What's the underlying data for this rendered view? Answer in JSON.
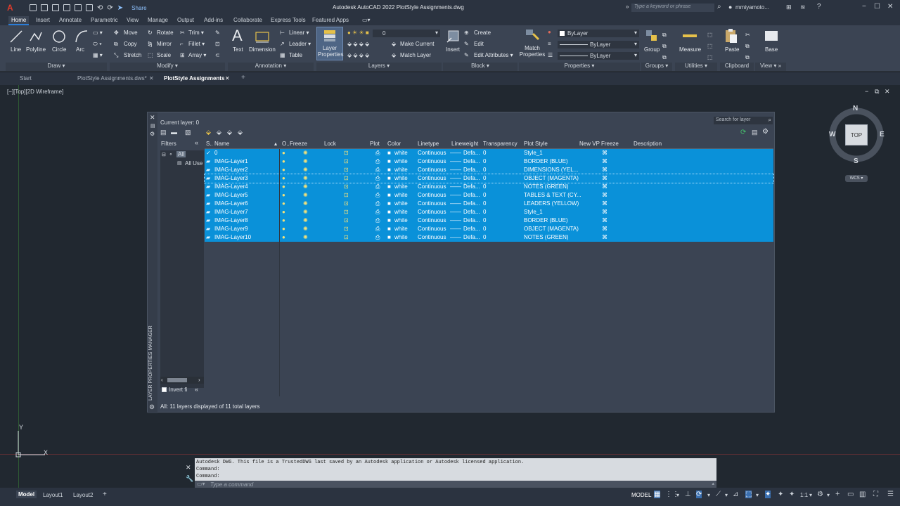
{
  "titlebar": {
    "logo": "A",
    "share": "Share",
    "title": "Autodesk AutoCAD 2022   PlotStyle Assignments.dwg",
    "search_placeholder": "Type a keyword or phrase",
    "user": "mmiyamoto..."
  },
  "ribbon_tabs": [
    "Home",
    "Insert",
    "Annotate",
    "Parametric",
    "View",
    "Manage",
    "Output",
    "Add-ins",
    "Collaborate",
    "Express Tools",
    "Featured Apps"
  ],
  "draw": {
    "line": "Line",
    "polyline": "Polyline",
    "circle": "Circle",
    "arc": "Arc",
    "panel": "Draw ▾"
  },
  "modify": {
    "move": "Move",
    "rotate": "Rotate",
    "trim": "Trim ▾",
    "copy": "Copy",
    "mirror": "Mirror",
    "fillet": "Fillet ▾",
    "stretch": "Stretch",
    "scale": "Scale",
    "array": "Array ▾",
    "panel": "Modify ▾"
  },
  "annotation": {
    "text": "Text",
    "dimension": "Dimension",
    "linear": "Linear ▾",
    "leader": "Leader ▾",
    "table": "Table",
    "panel": "Annotation ▾"
  },
  "layers": {
    "layer_properties": "Layer Properties",
    "current": "0",
    "make_current": "Make Current",
    "match_layer": "Match Layer",
    "panel": "Layers ▾"
  },
  "block": {
    "insert": "Insert",
    "create": "Create",
    "edit": "Edit",
    "edit_attributes": "Edit Attributes ▾",
    "panel": "Block ▾"
  },
  "properties": {
    "match": "Match Properties",
    "color": "ByLayer",
    "linetype": "ByLayer",
    "lineweight": "ByLayer",
    "panel": "Properties ▾"
  },
  "groups": {
    "group": "Group",
    "panel": "Groups ▾"
  },
  "utilities": {
    "measure": "Measure",
    "panel": "Utilities ▾"
  },
  "clipboard": {
    "paste": "Paste",
    "panel": "Clipboard"
  },
  "view": {
    "base": "Base",
    "panel": "View ▾  »"
  },
  "doc_tabs": [
    "Start",
    "PlotStyle Assignments.dws*",
    "PlotStyle Assignments"
  ],
  "viewport_label": "[−][Top][2D Wireframe]",
  "lpm": {
    "side_title": "LAYER PROPERTIES MANAGER",
    "current_layer": "Current layer: 0",
    "search_placeholder": "Search for layer",
    "filters_label": "Filters",
    "filter_all": "All",
    "filter_all_used": "All Use",
    "invert": "Invert fi",
    "status": "All: 11 layers displayed of 11 total layers",
    "headers": {
      "s": "S..",
      "name": "Name",
      "on": "O..",
      "freeze": "Freeze",
      "lock": "Lock",
      "plot": "Plot",
      "color": "Color",
      "linetype": "Linetype",
      "lineweight": "Lineweight",
      "transparency": "Transparency",
      "plotstyle": "Plot Style",
      "vpfreeze": "New VP Freeze",
      "description": "Description"
    },
    "rows": [
      {
        "name": "0",
        "color": "white",
        "linetype": "Continuous",
        "lineweight": "Defa...",
        "transparency": "0",
        "plotstyle": "Style_1"
      },
      {
        "name": "IMAG-Layer1",
        "color": "white",
        "linetype": "Continuous",
        "lineweight": "Defa...",
        "transparency": "0",
        "plotstyle": "BORDER (BLUE)"
      },
      {
        "name": "IMAG-Layer2",
        "color": "white",
        "linetype": "Continuous",
        "lineweight": "Defa...",
        "transparency": "0",
        "plotstyle": "DIMENSIONS  (YEL..."
      },
      {
        "name": "IMAG-Layer3",
        "color": "white",
        "linetype": "Continuous",
        "lineweight": "Defa...",
        "transparency": "0",
        "plotstyle": "OBJECT (MAGENTA)"
      },
      {
        "name": "IMAG-Layer4",
        "color": "white",
        "linetype": "Continuous",
        "lineweight": "Defa...",
        "transparency": "0",
        "plotstyle": "NOTES (GREEN)"
      },
      {
        "name": "IMAG-Layer5",
        "color": "white",
        "linetype": "Continuous",
        "lineweight": "Defa...",
        "transparency": "0",
        "plotstyle": "TABLES & TEXT (CY..."
      },
      {
        "name": "IMAG-Layer6",
        "color": "white",
        "linetype": "Continuous",
        "lineweight": "Defa...",
        "transparency": "0",
        "plotstyle": "LEADERS (YELLOW)"
      },
      {
        "name": "IMAG-Layer7",
        "color": "white",
        "linetype": "Continuous",
        "lineweight": "Defa...",
        "transparency": "0",
        "plotstyle": "Style_1"
      },
      {
        "name": "IMAG-Layer8",
        "color": "white",
        "linetype": "Continuous",
        "lineweight": "Defa...",
        "transparency": "0",
        "plotstyle": "BORDER (BLUE)"
      },
      {
        "name": "IMAG-Layer9",
        "color": "white",
        "linetype": "Continuous",
        "lineweight": "Defa...",
        "transparency": "0",
        "plotstyle": "OBJECT (MAGENTA)"
      },
      {
        "name": "IMAG-Layer10",
        "color": "white",
        "linetype": "Continuous",
        "lineweight": "Defa...",
        "transparency": "0",
        "plotstyle": "NOTES (GREEN)"
      }
    ]
  },
  "viewcube": {
    "n": "N",
    "s": "S",
    "e": "E",
    "w": "W",
    "top": "TOP",
    "wcs": "WCS"
  },
  "ucs": {
    "x": "X",
    "y": "Y"
  },
  "command": {
    "line1": "Autodesk DWG.  This file is a TrustedDWG last saved by an Autodesk application or Autodesk licensed application.",
    "line2": "Command:",
    "line3": "Command:",
    "placeholder": "Type a command"
  },
  "layout_tabs": [
    "Model",
    "Layout1",
    "Layout2"
  ],
  "status": {
    "model": "MODEL",
    "scale": "1:1"
  },
  "colors": {
    "accent": "#0a91d9",
    "background": "#212830",
    "panel": "#3b4453"
  }
}
